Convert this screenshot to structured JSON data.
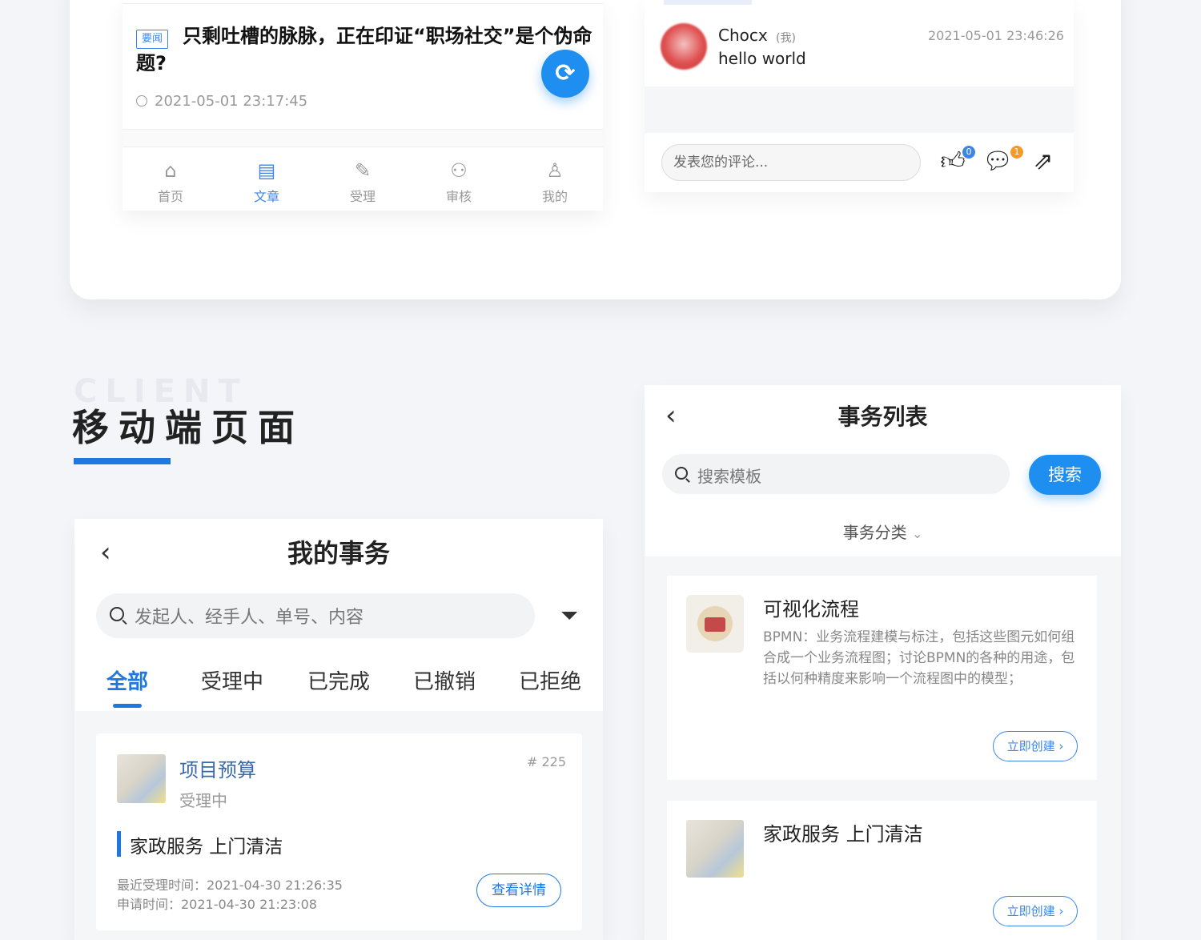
{
  "article": {
    "tag": "要闻",
    "title": "只剩吐槽的脉脉，正在印证“职场社交”是个伪命题?",
    "time": "2021-05-01 23:17:45",
    "refresh_icon": "refresh-icon",
    "tabs": [
      {
        "label": "首页",
        "icon": "home-icon",
        "glyph": "⌂"
      },
      {
        "label": "文章",
        "icon": "article-icon",
        "glyph": "▤"
      },
      {
        "label": "受理",
        "icon": "edit-icon",
        "glyph": "✎"
      },
      {
        "label": "审核",
        "icon": "review-icon",
        "glyph": "⚇"
      },
      {
        "label": "我的",
        "icon": "user-icon",
        "glyph": "♙"
      }
    ],
    "active_tab": "文章"
  },
  "comment": {
    "name": "Chocx",
    "me": "(我)",
    "time": "2021-05-01 23:46:26",
    "text": "hello world",
    "input_placeholder": "发表您的评论...",
    "like_count": "0",
    "comment_count": "1"
  },
  "section": {
    "watermark": "CLIENT",
    "title": "移动端页面"
  },
  "my_tasks": {
    "title": "我的事务",
    "search_placeholder": "发起人、经手人、单号、内容",
    "tabs": [
      "全部",
      "受理中",
      "已完成",
      "已撤销",
      "已拒绝"
    ],
    "active_tab": "全部",
    "card": {
      "name": "项目预算",
      "status": "受理中",
      "number": "# 225",
      "service": "家政服务 上门清洁",
      "recent": "最近受理时间：2021-04-30 21:26:35",
      "apply": "申请时间：2021-04-30 21:23:08",
      "detail_button": "查看详情"
    }
  },
  "task_list": {
    "title": "事务列表",
    "search_placeholder": "搜索模板",
    "search_button": "搜索",
    "category": "事务分类",
    "templates": [
      {
        "title": "可视化流程",
        "description": "BPMN：业务流程建模与标注，包括这些图元如何组合成一个业务流程图；讨论BPMN的各种的用途，包括以何种精度来影响一个流程图中的模型；",
        "button": "立即创建 ›"
      },
      {
        "title": "家政服务 上门清洁",
        "button": "立即创建 ›"
      }
    ]
  },
  "colors": {
    "accent": "#1e78e0",
    "button_blue": "#1e8ff0",
    "badge_blue": "#3e86e6",
    "badge_orange": "#f39a2b"
  }
}
